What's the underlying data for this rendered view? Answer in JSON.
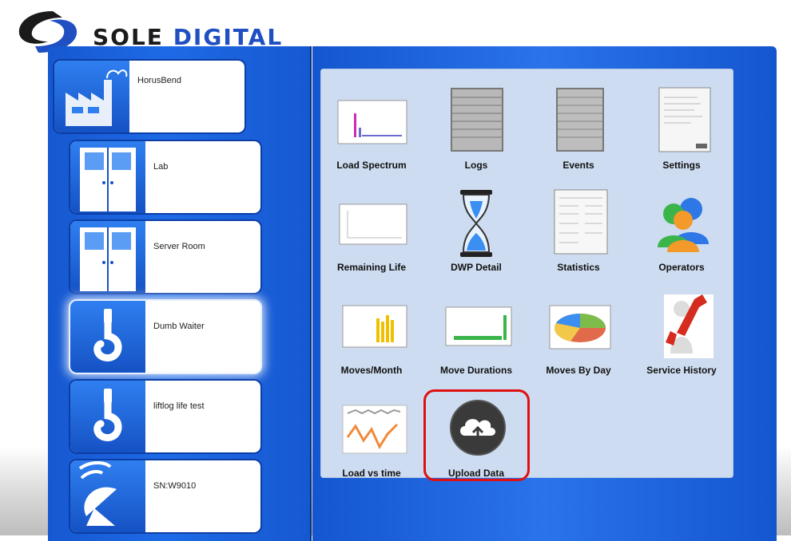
{
  "brand": {
    "name_part1": "SOLE",
    "name_part2": "DIGITAL",
    "accent_color": "#1f4fc1"
  },
  "sites": [
    {
      "label": "HorusBend",
      "icon": "factory-icon"
    },
    {
      "label": "Lab",
      "icon": "door-icon"
    },
    {
      "label": "Server Room",
      "icon": "door-icon"
    },
    {
      "label": "Dumb Waiter",
      "icon": "crane-hook-icon",
      "selected": true
    },
    {
      "label": "liftlog life test",
      "icon": "crane-hook-icon"
    },
    {
      "label": "SN:W9010",
      "icon": "satellite-dish-icon"
    }
  ],
  "tiles": [
    {
      "label": "Load Spectrum",
      "icon": "bar-chart-thumbnail-icon"
    },
    {
      "label": "Logs",
      "icon": "log-list-icon"
    },
    {
      "label": "Events",
      "icon": "events-list-icon"
    },
    {
      "label": "Settings",
      "icon": "settings-form-icon"
    },
    {
      "label": "Remaining Life",
      "icon": "life-chart-icon"
    },
    {
      "label": "DWP Detail",
      "icon": "hourglass-icon"
    },
    {
      "label": "Statistics",
      "icon": "statistics-report-icon"
    },
    {
      "label": "Operators",
      "icon": "people-icon"
    },
    {
      "label": "Moves/Month",
      "icon": "monthly-bar-chart-icon"
    },
    {
      "label": "Move Durations",
      "icon": "duration-chart-icon"
    },
    {
      "label": "Moves By Day",
      "icon": "pie-chart-icon"
    },
    {
      "label": "Service History",
      "icon": "service-wrench-icon"
    },
    {
      "label": "Load vs time",
      "icon": "line-chart-icon"
    },
    {
      "label": "Upload Data",
      "icon": "cloud-upload-icon"
    }
  ]
}
